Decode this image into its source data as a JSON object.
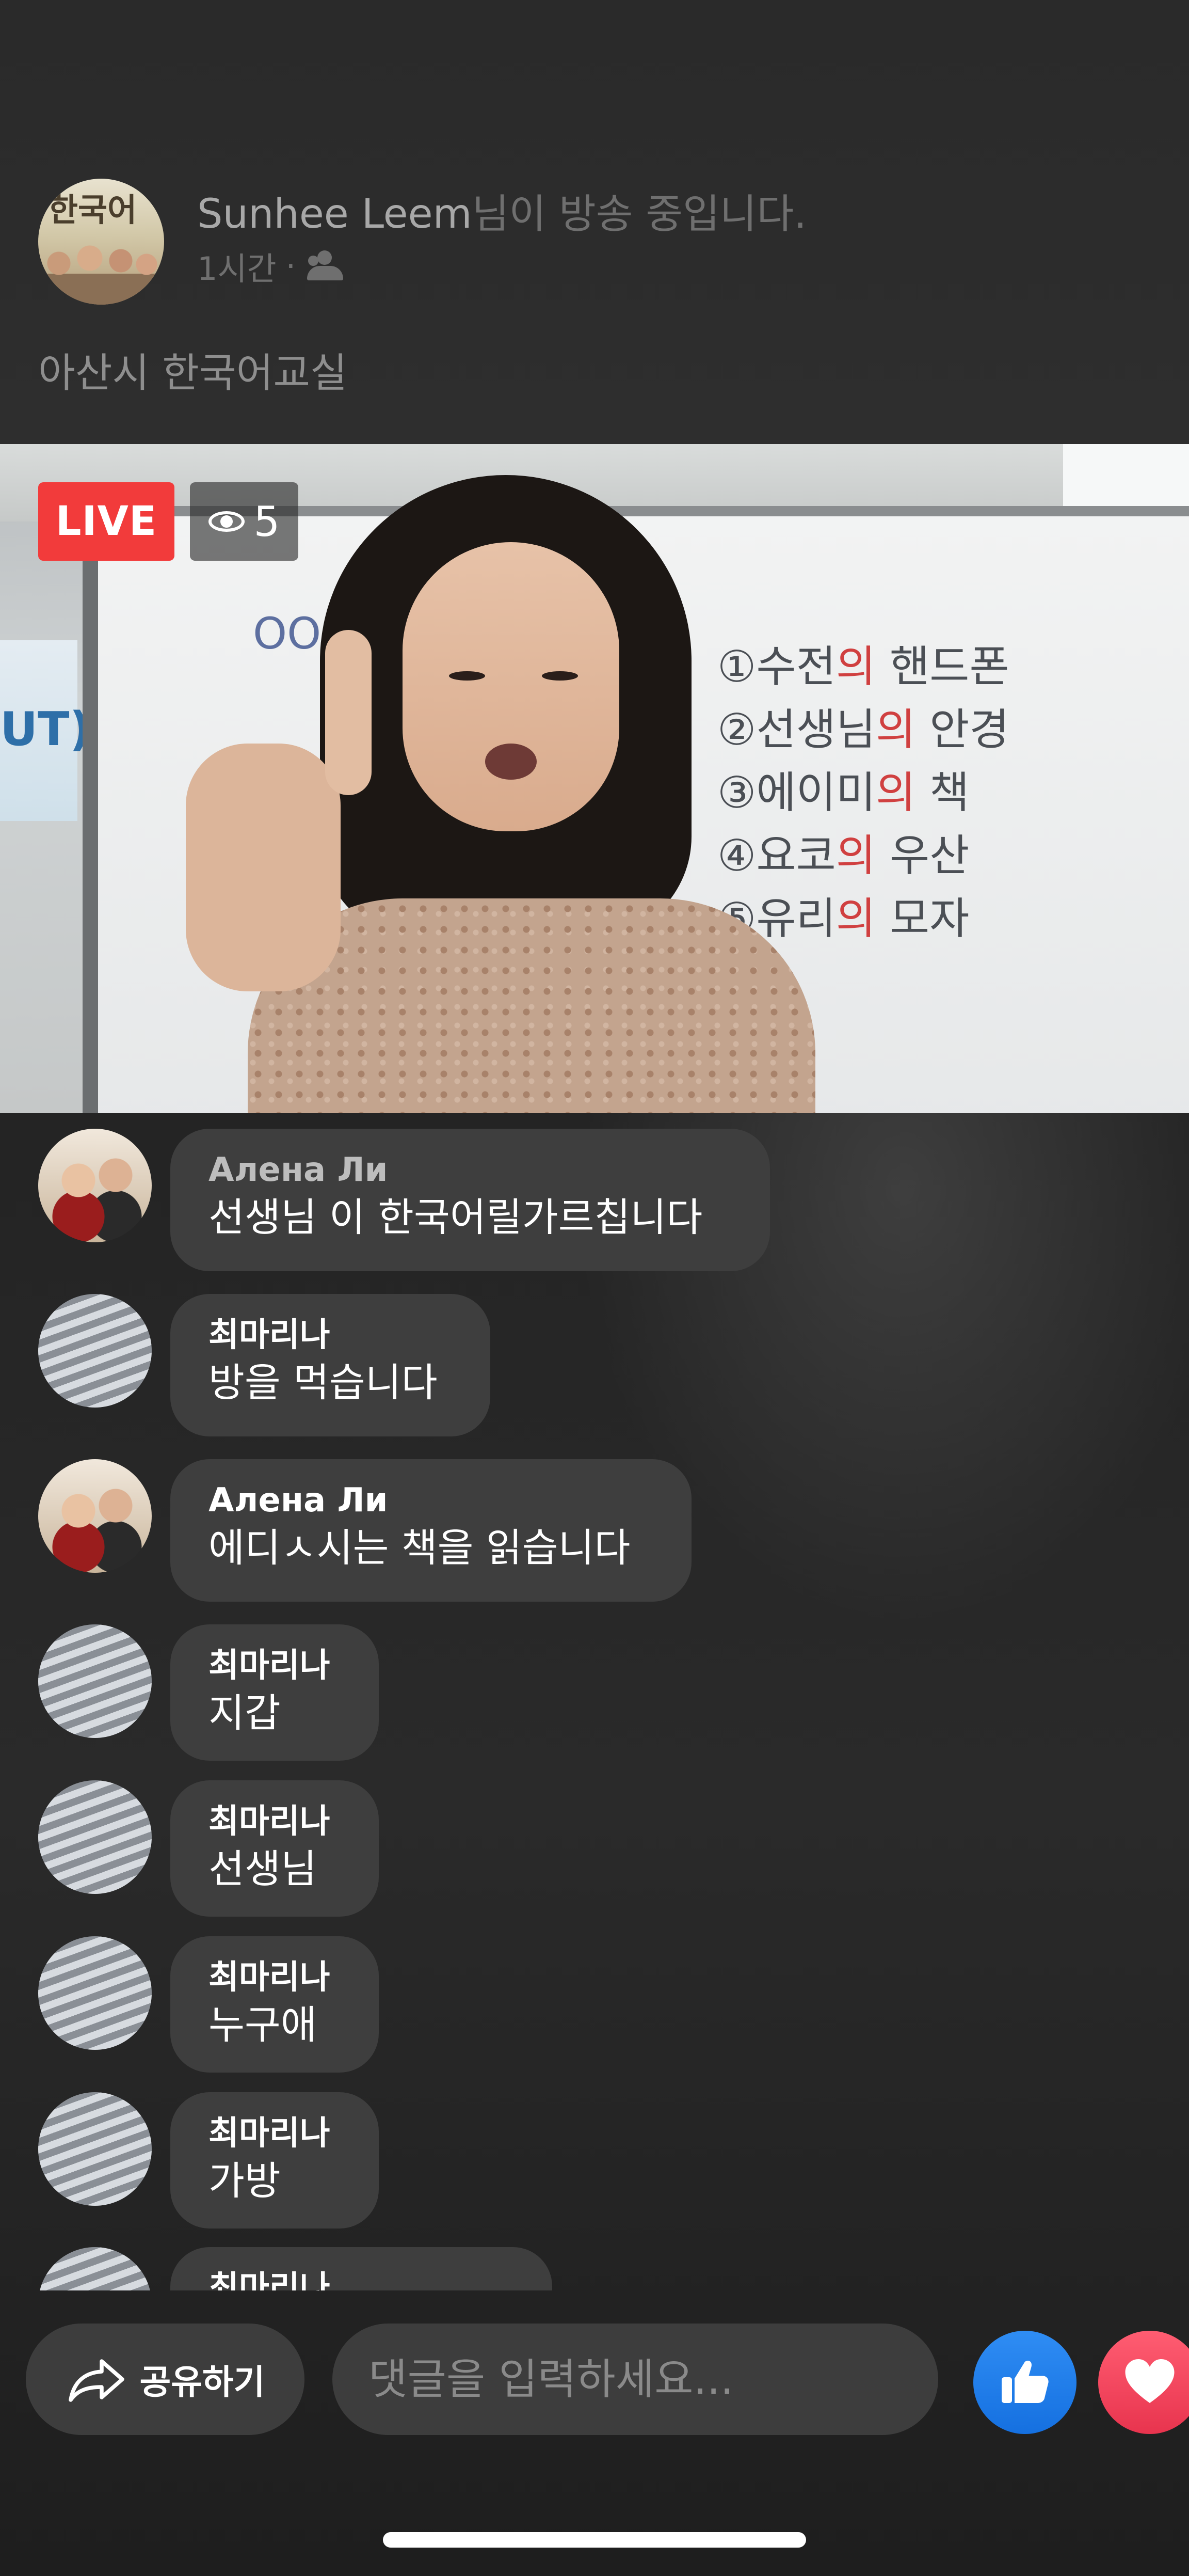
{
  "header": {
    "host_name": "Sunhee Leem",
    "broadcast_suffix": "님이 방송 중입니다.",
    "time_ago": "1시간",
    "separator": "·",
    "audience_icon": "friends-icon",
    "post_text": "아산시 한국어교실",
    "avatar_text": "한국어"
  },
  "video": {
    "live_label": "LIVE",
    "viewer_count": "5",
    "viewer_icon": "eye-icon",
    "board_lines": [
      {
        "num": "①",
        "a": "수전",
        "b": "의",
        "c": " 핸드폰"
      },
      {
        "num": "②",
        "a": "선생님",
        "b": "의",
        "c": " 안경"
      },
      {
        "num": "③",
        "a": "에이미",
        "b": "의",
        "c": " 책"
      },
      {
        "num": "④",
        "a": "요코",
        "b": "의",
        "c": " 우산"
      },
      {
        "num": "⑤",
        "a": "유리",
        "b": "의",
        "c": " 모자"
      }
    ],
    "board_left": "OO의",
    "poster_text": "UT)"
  },
  "comments": [
    {
      "name": "Алена Ли",
      "text": "선생님 이 한국어릴가르칩니다",
      "avatar": "alena"
    },
    {
      "name": "최마리나",
      "text": "방을 먹습니다",
      "avatar": "choi"
    },
    {
      "name": "Алена Ли",
      "text": "에디ㅅ시는 책을 읽습니다",
      "avatar": "alena"
    },
    {
      "name": "최마리나",
      "text": "지갑",
      "avatar": "choi"
    },
    {
      "name": "최마리나",
      "text": "선생님",
      "avatar": "choi"
    },
    {
      "name": "최마리나",
      "text": "누구애",
      "avatar": "choi"
    },
    {
      "name": "최마리나",
      "text": "가방",
      "avatar": "choi"
    },
    {
      "name": "최마리나",
      "text": "",
      "avatar": "choi"
    }
  ],
  "bottom_bar": {
    "share_label": "공유하기",
    "share_icon": "share-arrow-icon",
    "comment_placeholder": "댓글을 입력하세요...",
    "like_icon": "thumbs-up-icon",
    "love_icon": "heart-icon"
  },
  "colors": {
    "live_red": "#f23b3b",
    "like_blue": "#1877f2",
    "love_red": "#f0405a",
    "bubble_bg": "#3e3e3e"
  }
}
